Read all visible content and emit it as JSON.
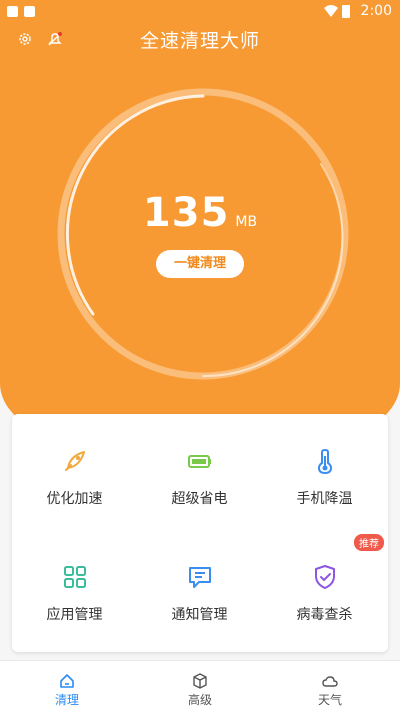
{
  "status_bar": {
    "time": "2:00"
  },
  "header": {
    "title": "全速清理大师"
  },
  "dial": {
    "value": "135",
    "unit": "MB",
    "button_label": "一键清理"
  },
  "features": [
    {
      "label": "优化加速",
      "icon": "rocket-icon",
      "color": "#f2a93b"
    },
    {
      "label": "超级省电",
      "icon": "battery-icon",
      "color": "#79c94a"
    },
    {
      "label": "手机降温",
      "icon": "thermometer-icon",
      "color": "#3a8ef0"
    },
    {
      "label": "应用管理",
      "icon": "grid-icon",
      "color": "#3bbd9b"
    },
    {
      "label": "通知管理",
      "icon": "message-icon",
      "color": "#3a8ef0"
    },
    {
      "label": "病毒查杀",
      "icon": "shield-icon",
      "color": "#8d55e3",
      "badge": "推荐"
    }
  ],
  "tabs": [
    {
      "label": "清理",
      "icon": "home-icon",
      "active": true
    },
    {
      "label": "高级",
      "icon": "box-icon",
      "active": false
    },
    {
      "label": "天气",
      "icon": "weather-icon",
      "active": false
    }
  ],
  "colors": {
    "accent": "#f79a33",
    "active_tab": "#2a8bf2",
    "badge": "#ef5a4b"
  }
}
